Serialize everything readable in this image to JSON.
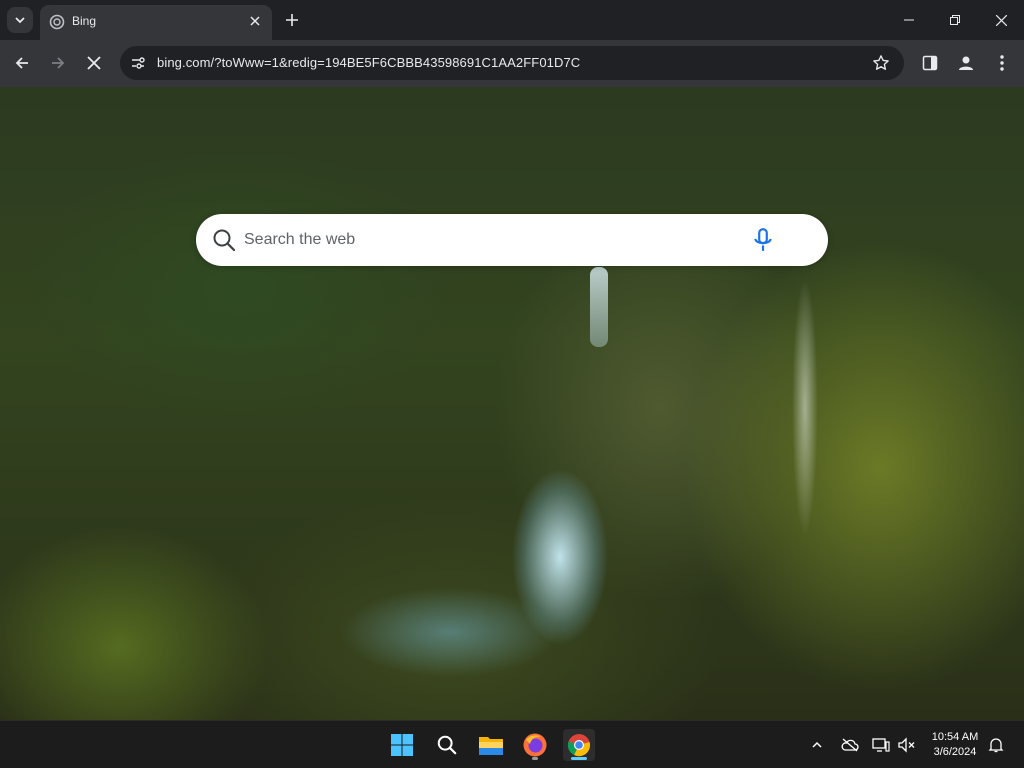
{
  "browser": {
    "tab": {
      "title": "Bing",
      "favicon": "bing-icon"
    },
    "url": "bing.com/?toWww=1&redig=194BE5F6CBBB43598691C1AA2FF01D7C"
  },
  "page": {
    "search": {
      "placeholder": "Search the web"
    },
    "background": "forest-waterfall-photo"
  },
  "taskbar": {
    "apps": [
      "start-icon",
      "search-icon",
      "file-explorer-icon",
      "firefox-icon",
      "chrome-icon"
    ],
    "time": "10:54 AM",
    "date": "3/6/2024"
  },
  "colors": {
    "tab_strip": "#202124",
    "toolbar": "#35363a",
    "taskbar": "#1c1c1c",
    "accent": "#60cdff"
  }
}
